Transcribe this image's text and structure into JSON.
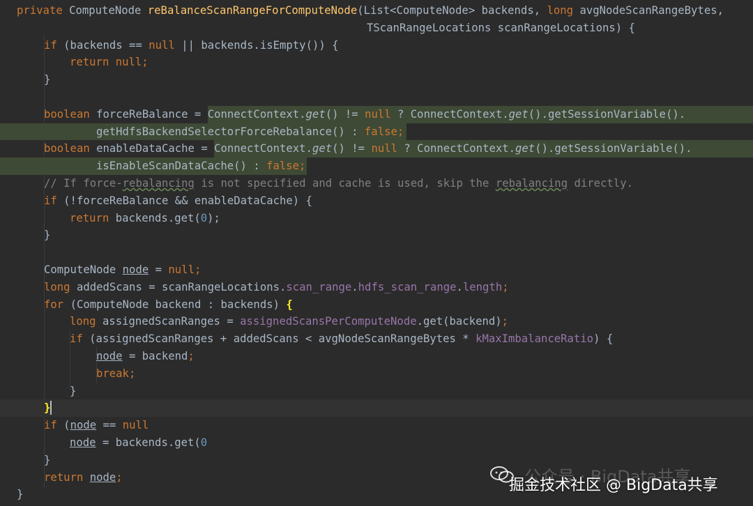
{
  "lines": [
    {
      "segs": [
        [
          "kw",
          "private "
        ],
        [
          "",
          "ComputeNode "
        ],
        [
          "fn",
          "reBalanceScanRangeForComputeNode"
        ],
        [
          "",
          "(List<ComputeNode> backends, "
        ],
        [
          "kw",
          "long "
        ],
        [
          "",
          "avgNodeScanRangeBytes,"
        ]
      ]
    },
    {
      "segs": [
        [
          "",
          "TScanRangeLocations scanRangeLocations) {"
        ]
      ]
    },
    {
      "segs": [
        [
          "kw",
          "if "
        ],
        [
          "",
          "(backends == "
        ],
        [
          "kw",
          "null "
        ],
        [
          "",
          "|| backends.isEmpty()) {"
        ]
      ]
    },
    {
      "segs": [
        [
          "kw",
          "return null"
        ],
        [
          "kw",
          ";"
        ]
      ]
    },
    {
      "segs": [
        [
          "",
          "}"
        ]
      ]
    },
    {
      "segs": []
    },
    {
      "segs": [
        [
          "kw",
          "boolean "
        ],
        [
          "",
          "forceReBalance = "
        ],
        [
          "",
          "ConnectContext."
        ],
        [
          "it",
          "get"
        ],
        [
          "",
          "() != "
        ],
        [
          "kw",
          "null "
        ],
        [
          "",
          "? ConnectContext."
        ],
        [
          "it",
          "get"
        ],
        [
          "",
          "().getSessionVariable()."
        ]
      ]
    },
    {
      "segs": [
        [
          "",
          "getHdfsBackendSelectorForceRebalance() : "
        ],
        [
          "kw",
          "false;"
        ]
      ]
    },
    {
      "segs": [
        [
          "kw",
          "boolean "
        ],
        [
          "",
          "enableDataCache = "
        ],
        [
          "",
          "ConnectContext."
        ],
        [
          "it",
          "get"
        ],
        [
          "",
          "() != "
        ],
        [
          "kw",
          "null "
        ],
        [
          "",
          "? ConnectContext."
        ],
        [
          "it",
          "get"
        ],
        [
          "",
          "().getSessionVariable()."
        ]
      ]
    },
    {
      "segs": [
        [
          "",
          "isEnableScanDataCache() : "
        ],
        [
          "kw",
          "false;"
        ]
      ]
    },
    {
      "segs": [
        [
          "cmt",
          "// If force-"
        ],
        [
          "cmt squig",
          "rebalancing"
        ],
        [
          "cmt",
          " is not specified and cache is used, skip the "
        ],
        [
          "cmt squig",
          "rebalancing"
        ],
        [
          "cmt",
          " directly."
        ]
      ]
    },
    {
      "segs": [
        [
          "kw",
          "if "
        ],
        [
          "",
          "(!forceReBalance && enableDataCache) {"
        ]
      ]
    },
    {
      "segs": [
        [
          "kw",
          "return "
        ],
        [
          "",
          "backends.get("
        ],
        [
          "num",
          "0"
        ],
        [
          "",
          "); "
        ]
      ]
    },
    {
      "segs": [
        [
          "",
          "}"
        ]
      ]
    },
    {
      "segs": []
    },
    {
      "segs": [
        [
          "",
          "ComputeNode "
        ],
        [
          "ul",
          "node"
        ],
        [
          "",
          " = "
        ],
        [
          "kw",
          "null;"
        ]
      ]
    },
    {
      "segs": [
        [
          "kw",
          "long "
        ],
        [
          "",
          "addedScans = scanRangeLocations."
        ],
        [
          "fld",
          "scan_range"
        ],
        [
          "",
          "."
        ],
        [
          "fld",
          "hdfs_scan_range"
        ],
        [
          "",
          "."
        ],
        [
          "fld",
          "length"
        ],
        [
          "kw",
          ";"
        ]
      ]
    },
    {
      "segs": [
        [
          "kw",
          "for "
        ],
        [
          "",
          "(ComputeNode backend : backends) "
        ],
        [
          "match",
          "{"
        ]
      ]
    },
    {
      "segs": [
        [
          "kw",
          "long "
        ],
        [
          "",
          "assignedScanRanges = "
        ],
        [
          "fld",
          "assignedScansPerComputeNode"
        ],
        [
          "",
          ".get(backend)"
        ],
        [
          "kw",
          ";"
        ]
      ]
    },
    {
      "segs": [
        [
          "kw",
          "if "
        ],
        [
          "",
          "(assignedScanRanges + addedScans < avgNodeScanRangeBytes * "
        ],
        [
          "fld",
          "kMaxImbalanceRatio"
        ],
        [
          "",
          ") {"
        ]
      ]
    },
    {
      "segs": [
        [
          "ul",
          "node"
        ],
        [
          "",
          " = backend"
        ],
        [
          "kw",
          ";"
        ]
      ]
    },
    {
      "segs": [
        [
          "kw",
          "break;"
        ]
      ]
    },
    {
      "segs": [
        [
          "",
          "}"
        ]
      ]
    },
    {
      "segs": [
        [
          "match",
          "}"
        ]
      ]
    },
    {
      "segs": [
        [
          "kw",
          "if "
        ],
        [
          "",
          "("
        ],
        [
          "ul",
          "node"
        ],
        [
          "",
          " == "
        ],
        [
          "kw",
          "null"
        ],
        [
          ") {"
        ]
      ]
    },
    {
      "segs": [
        [
          "ul",
          "node"
        ],
        [
          "",
          " = backends.get("
        ],
        [
          "num",
          "0"
        ],
        [
          ");"
        ]
      ]
    },
    {
      "segs": [
        [
          "",
          "}"
        ]
      ]
    },
    {
      "segs": [
        [
          "kw",
          "return "
        ],
        [
          "ul",
          "node"
        ],
        [
          "kw",
          ";"
        ]
      ]
    },
    {
      "segs": [
        [
          "",
          "}"
        ]
      ]
    }
  ],
  "watermark": {
    "ghost_text": "公众号 · BigData共享",
    "main_text": "掘金技术社区 @ BigData共享",
    "icon": "wechat-icon"
  },
  "colors": {
    "background": "#2b2b2b",
    "keyword": "#cc7832",
    "method": "#ffc66d",
    "number": "#6897bb",
    "comment": "#808080",
    "field": "#9876aa",
    "text": "#a9b7c6"
  }
}
